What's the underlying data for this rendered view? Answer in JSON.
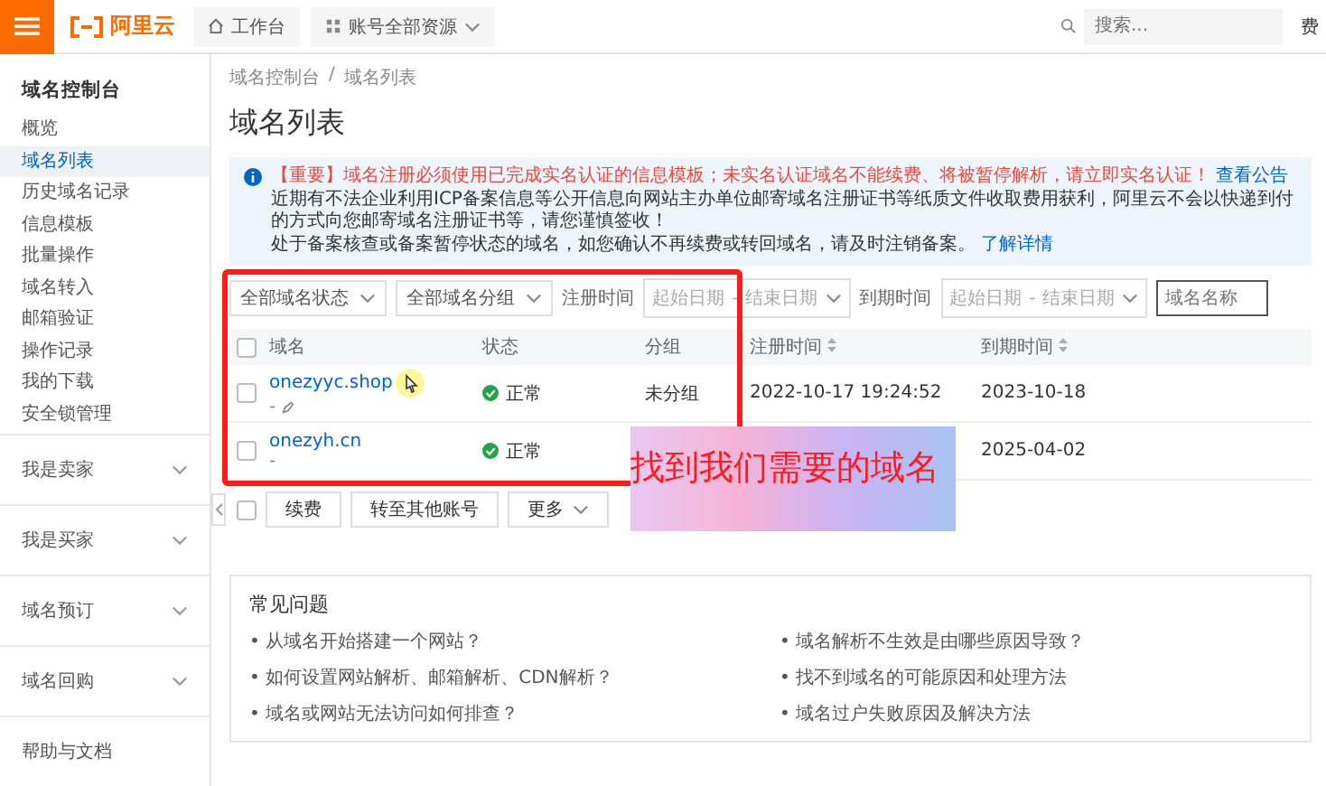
{
  "top_bar": {
    "logo_text": "阿里云",
    "nav": [
      {
        "label": "工作台",
        "kind": "home"
      },
      {
        "label": "账号全部资源",
        "kind": "dropdown"
      }
    ],
    "search": {
      "placeholder": "搜索..."
    },
    "account_text": "费"
  },
  "sidebar": {
    "title": "域名控制台",
    "items": [
      {
        "label": "概览",
        "selected": false
      },
      {
        "label": "域名列表",
        "selected": true
      },
      {
        "label": "历史域名记录",
        "selected": false
      },
      {
        "label": "信息模板",
        "selected": false
      },
      {
        "label": "批量操作",
        "selected": false
      },
      {
        "label": "域名转入",
        "selected": false
      },
      {
        "label": "邮箱验证",
        "selected": false
      },
      {
        "label": "操作记录",
        "selected": false
      },
      {
        "label": "我的下载",
        "selected": false
      },
      {
        "label": "安全锁管理",
        "selected": false
      }
    ],
    "sections": [
      {
        "label": "我是卖家",
        "expanded": false
      },
      {
        "label": "我是买家",
        "expanded": false
      },
      {
        "label": "域名预订",
        "expanded": false
      },
      {
        "label": "域名回购",
        "expanded": false
      }
    ],
    "footer": "帮助与文档"
  },
  "breadcrumb": {
    "items": [
      "域名控制台",
      "域名列表"
    ],
    "separator": "/"
  },
  "page_title": "域名列表",
  "notice": {
    "lines": [
      {
        "kind": "warning",
        "text": "【重要】域名注册必须使用已完成实名认证的信息模板；未实名认证域名不能续费、将被暂停解析，请立即实名认证！",
        "link": "查看公告"
      },
      {
        "kind": "plain",
        "text": "近期有不法企业利用ICP备案信息等公开信息向网站主办单位邮寄域名注册证书等纸质文件收取费用获利，阿里云不会以快递到付的方式向您邮寄域名注册证书等，请您谨慎签收！"
      },
      {
        "kind": "plain",
        "text": "处于备案核查或备案暂停状态的域名，如您确认不再续费或转回域名，请及时注销备案。",
        "link": "了解详情"
      }
    ]
  },
  "filters": [
    {
      "kind": "select",
      "label": "全部域名状态"
    },
    {
      "kind": "select",
      "label": "全部域名分组"
    },
    {
      "kind": "date_range",
      "label": "注册时间",
      "start_placeholder": "起始日期",
      "separator": "-",
      "end_placeholder": "结束日期"
    },
    {
      "kind": "date_range",
      "label": "到期时间",
      "start_placeholder": "起始日期",
      "separator": "-",
      "end_placeholder": "结束日期"
    },
    {
      "kind": "input",
      "placeholder": "域名名称"
    }
  ],
  "table": {
    "header_checked": false,
    "columns": [
      {
        "label": "域名",
        "sortable": false
      },
      {
        "label": "状态",
        "sortable": false
      },
      {
        "label": "分组",
        "sortable": false
      },
      {
        "label": "注册时间",
        "sortable": true
      },
      {
        "label": "到期时间",
        "sortable": true
      }
    ],
    "rows": [
      {
        "checked": false,
        "hovered": true,
        "domain": "onezyyc.shop",
        "note": "-",
        "status": "正常",
        "group": "未分组",
        "registered": "2022-10-17 19:24:52",
        "expires": "2023-10-18"
      },
      {
        "checked": false,
        "hovered": false,
        "domain": "onezyh.cn",
        "note": "-",
        "status": "正常",
        "expires": "2025-04-02"
      }
    ]
  },
  "bulk_actions": {
    "checked": false,
    "buttons": [
      {
        "label": "续费",
        "kind": "button"
      },
      {
        "label": "转至其他账号",
        "kind": "button"
      },
      {
        "label": "更多",
        "kind": "dropdown"
      }
    ]
  },
  "faq": {
    "title": "常见问题",
    "bullet": "•",
    "left": [
      "从域名开始搭建一个网站？",
      "如何设置网站解析、邮箱解析、CDN解析？",
      "域名或网站无法访问如何排查？"
    ],
    "right": [
      "域名解析不生效是由哪些原因导致？",
      "找不到域名的可能原因和处理方法",
      "域名过户失败原因及解决方法"
    ]
  },
  "annotation": {
    "caption": "找到我们需要的域名"
  }
}
